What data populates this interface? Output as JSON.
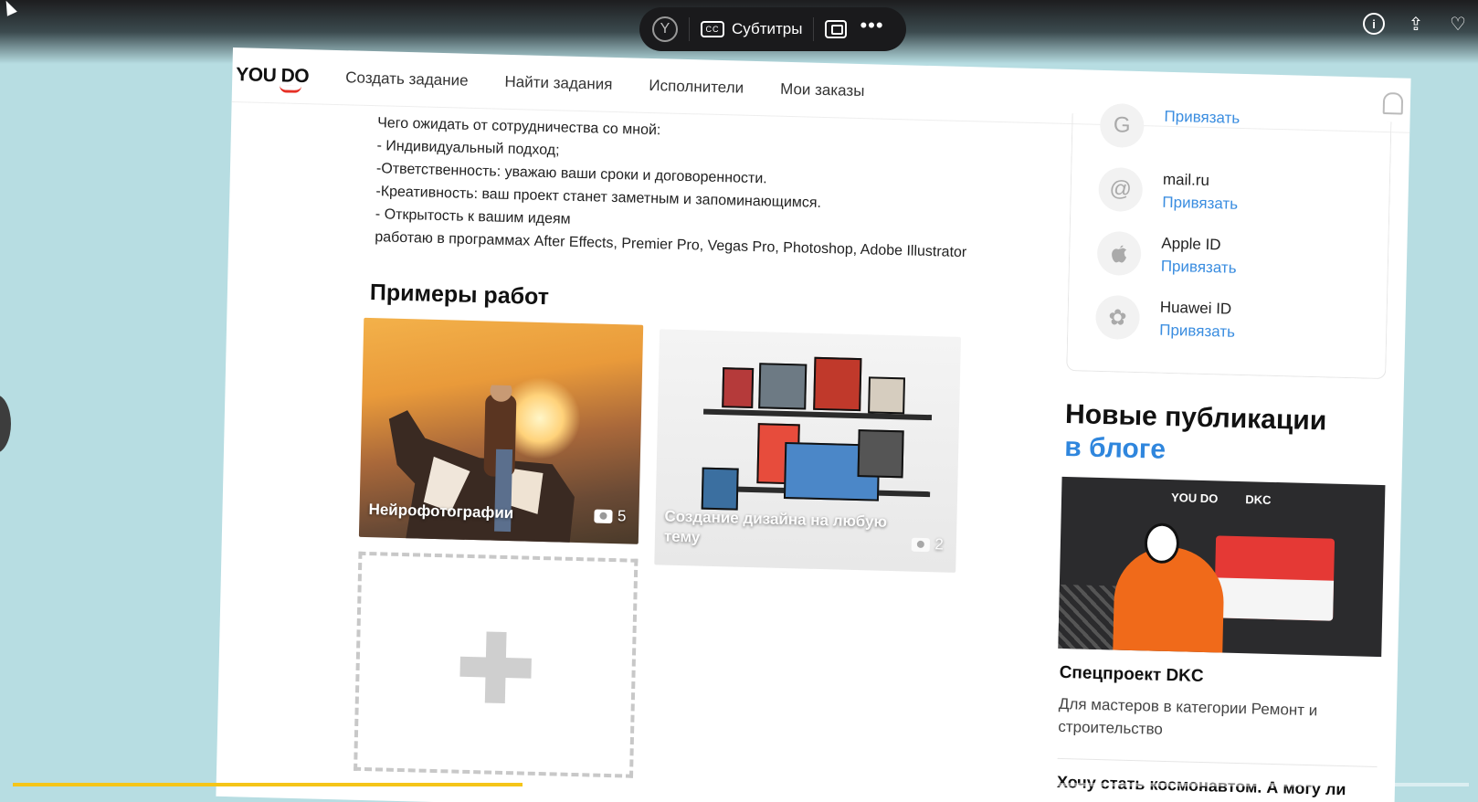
{
  "player": {
    "subtitles_label": "Субтитры",
    "yandex_glyph": "Y",
    "cc_glyph": "CC",
    "more_glyph": "•••",
    "progress": 0.35
  },
  "site": {
    "logo": "YOU DO",
    "nav": [
      "Создать задание",
      "Найти задания",
      "Исполнители",
      "Мои заказы"
    ]
  },
  "profile": {
    "about_lines": [
      "Чего ожидать от сотрудничества со мной:",
      "- Индивидуальный подход;",
      "-Ответственность: уважаю ваши сроки и договоренности.",
      "-Креативность: ваш проект станет заметным и запоминающимся.",
      "- Открытость к вашим идеям",
      "работаю в программах After Effects, Premier Pro, Vegas Pro, Photoshop, Adobe Illustrator"
    ],
    "portfolio_title": "Примеры работ",
    "portfolio": [
      {
        "caption": "Нейрофотографии",
        "count": "5"
      },
      {
        "caption": "Создание дизайна на любую тему",
        "count": "2"
      }
    ]
  },
  "bindings": {
    "items": [
      {
        "name": "",
        "icon": "G",
        "link": "Привязать"
      },
      {
        "name": "mail.ru",
        "icon": "@",
        "link": "Привязать"
      },
      {
        "name": "Apple ID",
        "icon": "",
        "link": "Привязать"
      },
      {
        "name": "Huawei ID",
        "icon": "✿",
        "link": "Привязать"
      }
    ]
  },
  "blog": {
    "title_line1": "Новые публикации",
    "title_line2": "в блоге",
    "image_logos": [
      "YOU DO",
      "DKC"
    ],
    "post_title": "Спецпроект DKC",
    "post_desc": "Для мастеров в категории Ремонт и строительство",
    "next_post": "Хочу стать космонавтом. А могу ли"
  },
  "colors": {
    "background": "#b7dde2",
    "link": "#3a8de0",
    "brand_red": "#e63026",
    "progress": "#f5c518"
  }
}
